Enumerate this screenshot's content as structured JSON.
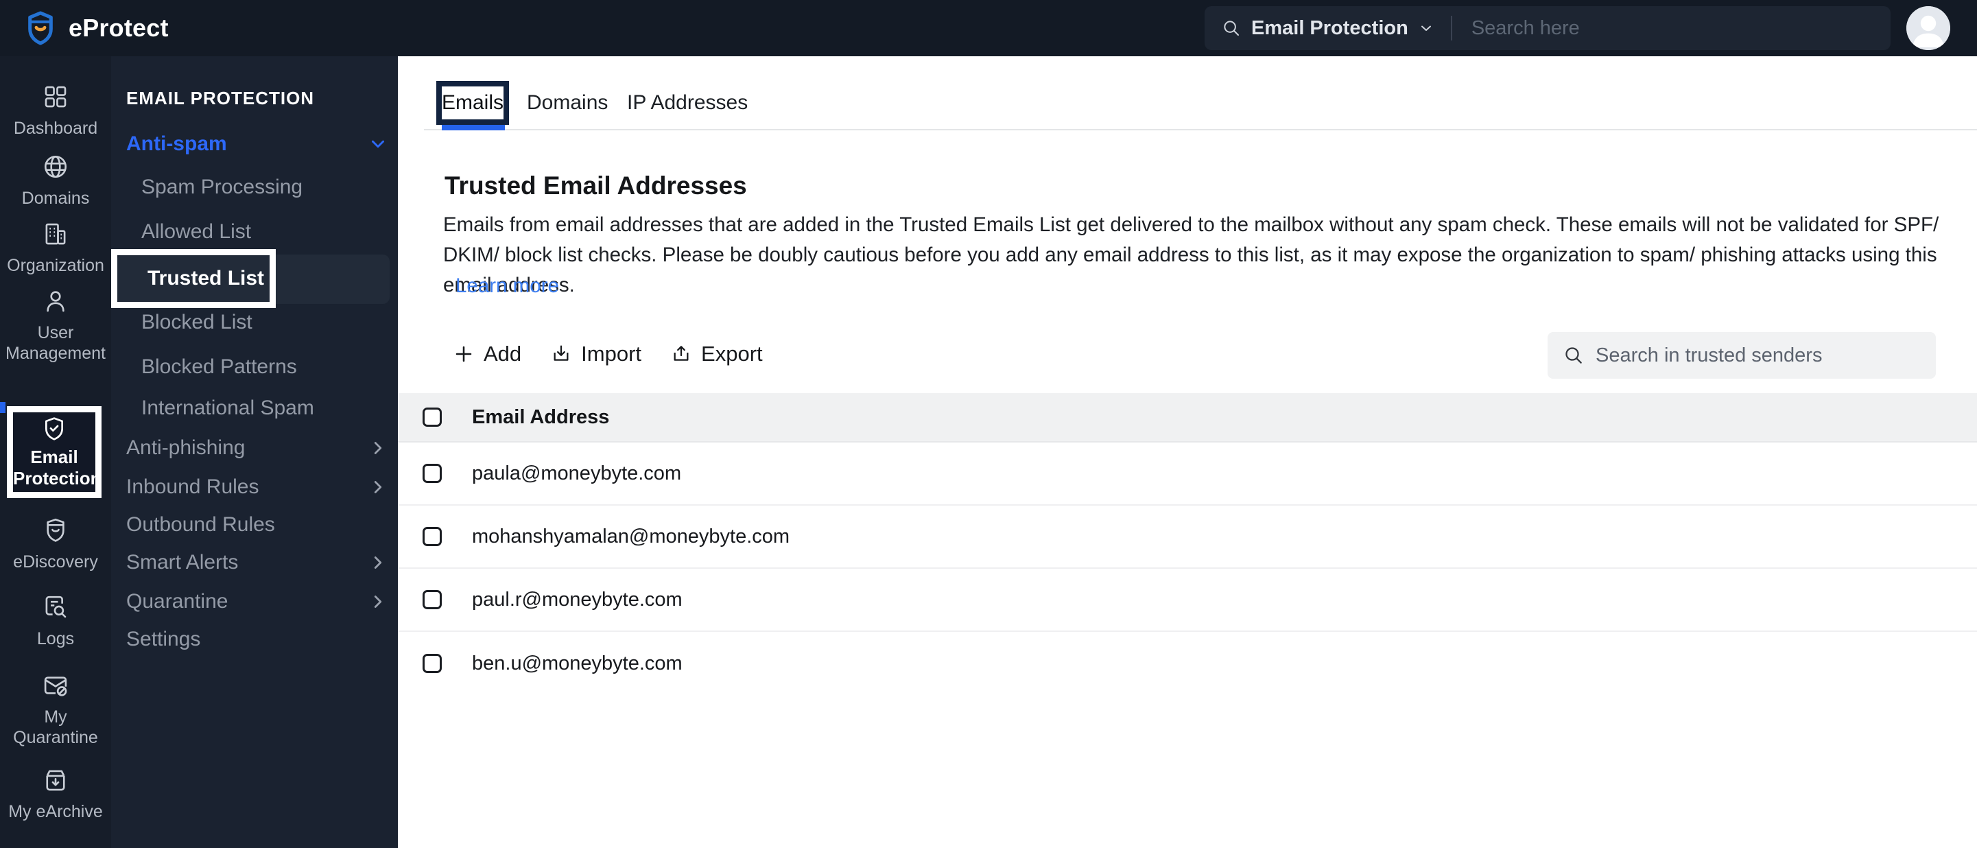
{
  "colors": {
    "header_bg": "#131a25",
    "rail_bg": "#161d29",
    "panel_bg": "#1a2230",
    "accent_blue": "#2d68f8",
    "tab_underline_blue": "#2563eb",
    "annotation_white": "#ffffff",
    "annotation_navy": "#12233f",
    "link_blue": "#3d7ef0",
    "logo_blue": "#2472d2",
    "logo_orange": "#f2a33c",
    "table_header_bg": "#f0f1f2"
  },
  "header": {
    "app_name": "eProtect",
    "search_scope": "Email Protection",
    "search_placeholder": "Search here"
  },
  "rail": {
    "items": [
      {
        "label": "Dashboard"
      },
      {
        "label": "Domains"
      },
      {
        "label": "Organization"
      },
      {
        "label": "User Management"
      },
      {
        "label": "Email Protection",
        "active": true,
        "highlighted": true
      },
      {
        "label": "eDiscovery"
      },
      {
        "label": "Logs"
      },
      {
        "label": "My Quarantine"
      },
      {
        "label": "My eArchive"
      }
    ]
  },
  "nav": {
    "section_title": "EMAIL PROTECTION",
    "items": [
      {
        "label": "Anti-spam",
        "expanded": true,
        "active_parent": true
      },
      {
        "label": "Spam Processing",
        "child": true
      },
      {
        "label": "Allowed List",
        "child": true
      },
      {
        "label": "Trusted List",
        "child": true,
        "active": true,
        "highlighted": true
      },
      {
        "label": "Blocked List",
        "child": true
      },
      {
        "label": "Blocked Patterns",
        "child": true
      },
      {
        "label": "International Spam",
        "child": true
      },
      {
        "label": "Anti-phishing",
        "has_submenu": true
      },
      {
        "label": "Inbound Rules",
        "has_submenu": true
      },
      {
        "label": "Outbound Rules"
      },
      {
        "label": "Smart Alerts",
        "has_submenu": true
      },
      {
        "label": "Quarantine",
        "has_submenu": true
      },
      {
        "label": "Settings"
      }
    ]
  },
  "main": {
    "tabs": [
      {
        "label": "Emails",
        "active": true,
        "highlighted": true
      },
      {
        "label": "Domains"
      },
      {
        "label": "IP Addresses"
      }
    ],
    "page_title": "Trusted Email Addresses",
    "description": "Emails from email addresses that are added in the Trusted Emails List get delivered to the mailbox without any spam check. These emails will not be validated for SPF/ DKIM/ block list checks. Please be doubly cautious before you add any email address to this list, as it may expose the organization to spam/ phishing attacks using this email address.",
    "learn_more_label": "Learn more",
    "toolbar": {
      "add_label": "Add",
      "import_label": "Import",
      "export_label": "Export"
    },
    "search_placeholder": "Search in trusted senders",
    "table": {
      "column_header": "Email Address",
      "rows": [
        {
          "email": "paula@moneybyte.com"
        },
        {
          "email": "mohanshyamalan@moneybyte.com"
        },
        {
          "email": "paul.r@moneybyte.com"
        },
        {
          "email": "ben.u@moneybyte.com"
        }
      ]
    }
  }
}
